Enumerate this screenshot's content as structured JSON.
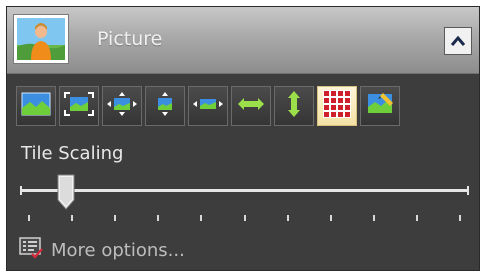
{
  "panel": {
    "title": "Picture",
    "header_icon": "picture-icon",
    "collapse_icon": "chevron-up-icon"
  },
  "toolbar": {
    "buttons": [
      {
        "icon": "landscape-icon",
        "active": false
      },
      {
        "icon": "fit-frame-icon",
        "active": false
      },
      {
        "icon": "stretch-icon",
        "active": false
      },
      {
        "icon": "center-vertical-icon",
        "active": false
      },
      {
        "icon": "center-horizontal-icon",
        "active": false
      },
      {
        "icon": "fit-width-icon",
        "active": false
      },
      {
        "icon": "fit-height-icon",
        "active": false
      },
      {
        "icon": "tile-icon",
        "active": true
      },
      {
        "icon": "picture-edit-icon",
        "active": false
      }
    ]
  },
  "tile_scaling": {
    "label": "Tile Scaling",
    "slider_fraction": 0.1,
    "tick_count": 11
  },
  "more_options": {
    "label": "More options...",
    "icon": "options-list-icon"
  },
  "colors": {
    "panel_bg": "#3d3d3d",
    "accent_green": "#8ed83c",
    "active_tile": "#cf1f2a"
  }
}
